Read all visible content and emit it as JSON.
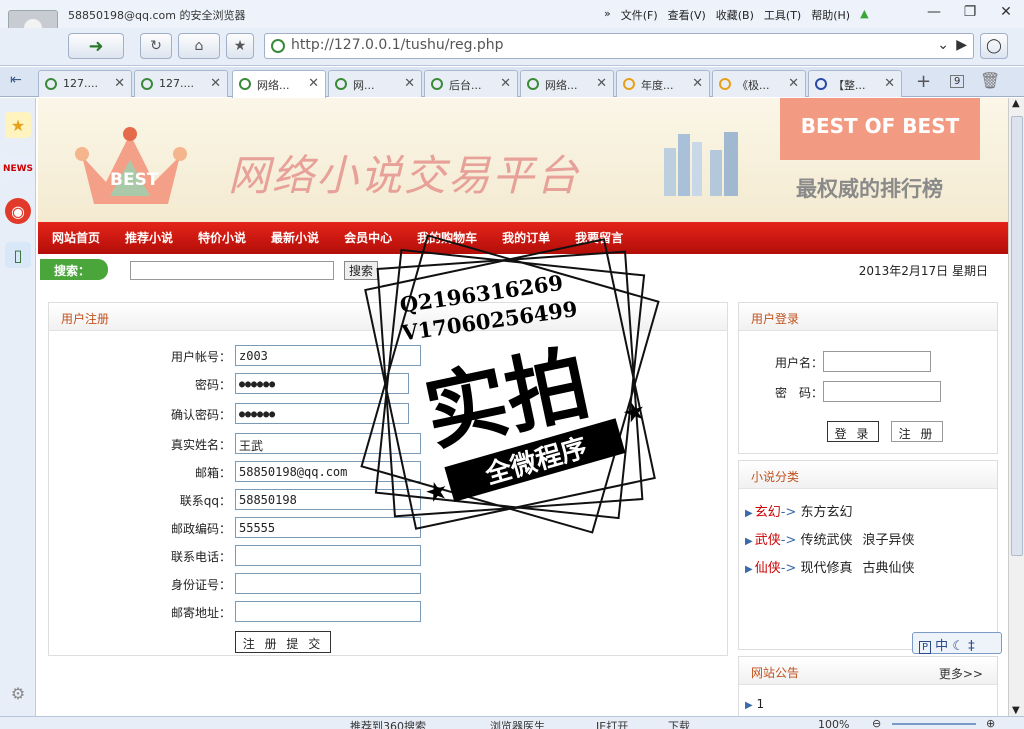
{
  "browser": {
    "user_label": "58850198@qq.com 的安全浏览器",
    "menu": [
      "文件(F)",
      "查看(V)",
      "收藏(B)",
      "工具(T)",
      "帮助(H)"
    ],
    "menu_arrow": "»",
    "address": "http://127.0.0.1/tushu/reg.php",
    "tabs": [
      {
        "label": "127....",
        "active": false
      },
      {
        "label": "127....",
        "active": false
      },
      {
        "label": "网络...",
        "active": true
      },
      {
        "label": "网...",
        "active": false
      },
      {
        "label": "后台...",
        "active": false
      },
      {
        "label": "网络...",
        "active": false
      },
      {
        "label": "年度...",
        "active": false
      },
      {
        "label": "《极...",
        "active": false
      },
      {
        "label": "【整...",
        "active": false
      }
    ],
    "tab_count_badge": "9"
  },
  "banner": {
    "crown_text": "BEST",
    "site_title": "网络小说交易平台",
    "ribbon": "BEST OF BEST",
    "slogan": "最权威的排行榜"
  },
  "nav": [
    "网站首页",
    "推荐小说",
    "特价小说",
    "最新小说",
    "会员中心",
    "我的购物车",
    "我的订单",
    "我要留言"
  ],
  "search": {
    "label": "搜索：",
    "button": "搜索",
    "date": "2013年2月17日 星期日"
  },
  "register": {
    "title": "用户注册",
    "fields": [
      {
        "label": "用户帐号：",
        "value": "z003"
      },
      {
        "label": "密码：",
        "value": "●●●●●●"
      },
      {
        "label": "确认密码：",
        "value": "●●●●●●"
      },
      {
        "label": "真实姓名：",
        "value": "王武"
      },
      {
        "label": "邮箱：",
        "value": "58850198@qq.com"
      },
      {
        "label": "联系qq：",
        "value": "58850198"
      },
      {
        "label": "邮政编码：",
        "value": "55555"
      },
      {
        "label": "联系电话：",
        "value": ""
      },
      {
        "label": "身份证号：",
        "value": ""
      },
      {
        "label": "邮寄地址：",
        "value": ""
      }
    ],
    "submit": "注 册 提 交"
  },
  "login": {
    "title": "用户登录",
    "username_label": "用户名：",
    "password_label": "密　码：",
    "login_btn": "登 录",
    "register_btn": "注 册"
  },
  "categories": {
    "title": "小说分类",
    "items": [
      {
        "name": "玄幻",
        "sep": "->",
        "subs": [
          "东方玄幻"
        ]
      },
      {
        "name": "武侠",
        "sep": "->",
        "subs": [
          "传统武侠",
          "浪子异侠"
        ]
      },
      {
        "name": "仙侠",
        "sep": "->",
        "subs": [
          "现代修真",
          "古典仙侠"
        ]
      }
    ]
  },
  "notice": {
    "title": "网站公告",
    "more": "更多>>",
    "first_item": "1"
  },
  "watermark": {
    "line1": "Q2196316269",
    "line2": "V17060256499",
    "main": "实拍",
    "banner": "全微程序"
  },
  "ime": "中",
  "statusbar": {
    "items": [
      "推荐到360搜索",
      "浏览器医生",
      "IE打开",
      "下载",
      "100%"
    ]
  }
}
